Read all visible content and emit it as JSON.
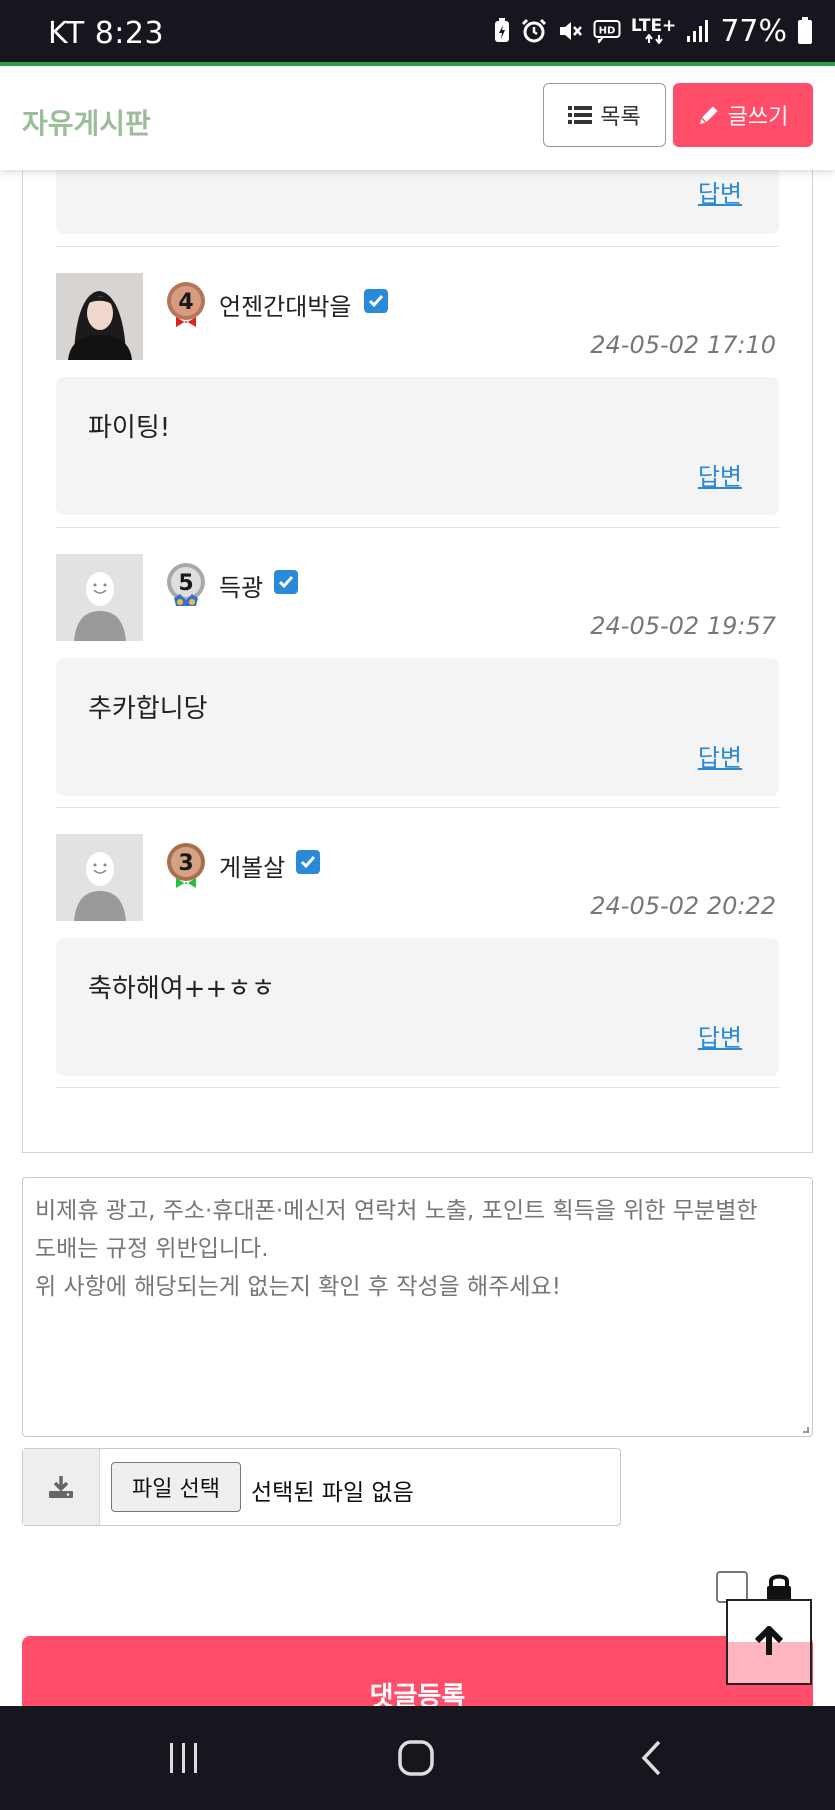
{
  "status_bar": {
    "carrier_time": "KT 8:23",
    "network": "LTE+",
    "battery": "77%",
    "icons": [
      "battery-saver-icon",
      "alarm-icon",
      "mute-icon",
      "hd-voice-icon",
      "lte-icon",
      "signal-icon",
      "battery-icon"
    ]
  },
  "header": {
    "title": "자유게시판",
    "list_label": "목록",
    "write_label": "글쓰기"
  },
  "comments": {
    "top_reply_label": "답변",
    "items": [
      {
        "level": "4",
        "nickname": "언젠간대박을",
        "date": "24-05-02 17:10",
        "text": "파이팅!",
        "reply_label": "답변",
        "avatar": "photo"
      },
      {
        "level": "5",
        "nickname": "득광",
        "date": "24-05-02 19:57",
        "text": "추카합니당",
        "reply_label": "답변",
        "avatar": "default"
      },
      {
        "level": "3",
        "nickname": "게볼살",
        "date": "24-05-02 20:22",
        "text": "축하해여++ㅎㅎ",
        "reply_label": "답변",
        "avatar": "default"
      }
    ]
  },
  "comment_form": {
    "placeholder_lines": [
      "비제휴 광고, 주소·휴대폰·메신저 연락처 노출, 포인트 획득을 위한 무분별한",
      "도배는 규정 위반입니다.",
      "위 사항에 해당되는게 없는지 확인 후 작성을 해주세요!"
    ],
    "file_button_label": "파일 선택",
    "file_status": "선택된 파일 없음",
    "submit_label": "댓글등록"
  },
  "colors": {
    "accent": "#ff4d6a",
    "title": "#9bbd97",
    "link": "#2a8ad8",
    "status_bar": "#15161e"
  }
}
